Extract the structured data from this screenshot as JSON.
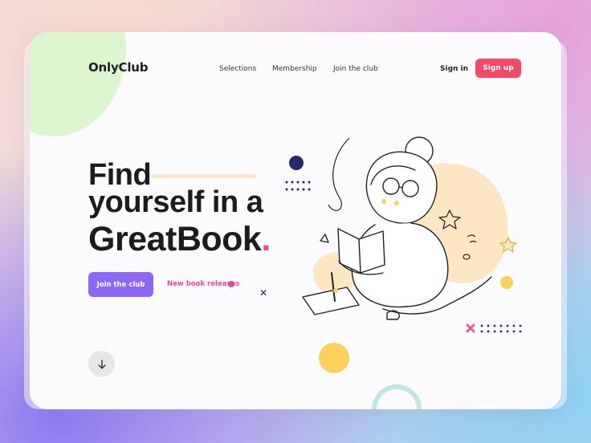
{
  "brand": {
    "name": "OnlyClub"
  },
  "nav": {
    "items": [
      {
        "label": "Selections"
      },
      {
        "label": "Membership"
      },
      {
        "label": "Join the club"
      }
    ],
    "sign_in": "Sign in",
    "sign_up": "Sign up"
  },
  "hero": {
    "line1": "Find",
    "line2": "yourself in a",
    "line3": "GreatBook",
    "line3_dot": ".",
    "cta_label": "Join the club",
    "secondary_link": "New book releases"
  },
  "icons": {
    "scroll_down": "arrow-down-icon",
    "link_dot": "dot-icon",
    "decor": [
      "star-icon",
      "cross-icon",
      "dot-grid-icon"
    ]
  },
  "colors": {
    "accent_pink": "#f24a66",
    "primary_purple": "#8b68f6",
    "link_pink": "#e8479b",
    "illustration_yellow": "#fcd66e",
    "illustration_peach": "#fde6c3",
    "navy": "#1e2154"
  }
}
